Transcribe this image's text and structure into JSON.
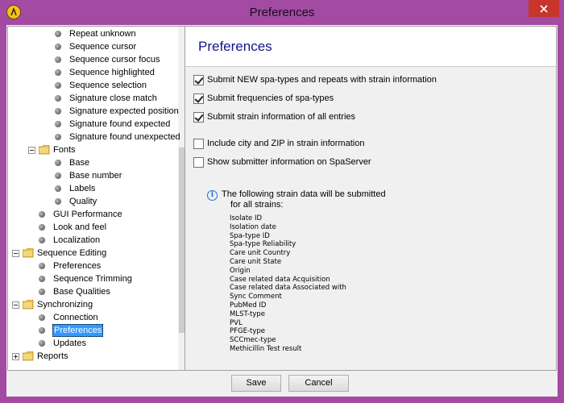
{
  "window": {
    "title": "Preferences",
    "accent_color": "#a34aa3",
    "close_color": "#c7352b"
  },
  "tree": {
    "items": [
      {
        "label": "Repeat unknown",
        "type": "leaf",
        "level": 3
      },
      {
        "label": "Sequence cursor",
        "type": "leaf",
        "level": 3
      },
      {
        "label": "Sequence cursor focus",
        "type": "leaf",
        "level": 3
      },
      {
        "label": "Sequence highlighted",
        "type": "leaf",
        "level": 3
      },
      {
        "label": "Sequence selection",
        "type": "leaf",
        "level": 3
      },
      {
        "label": "Signature close match",
        "type": "leaf",
        "level": 3
      },
      {
        "label": "Signature expected position",
        "type": "leaf",
        "level": 3
      },
      {
        "label": "Signature found expected",
        "type": "leaf",
        "level": 3
      },
      {
        "label": "Signature found unexpected",
        "type": "leaf",
        "level": 3
      },
      {
        "label": "Fonts",
        "type": "folder-open",
        "level": 2
      },
      {
        "label": "Base",
        "type": "leaf",
        "level": 3
      },
      {
        "label": "Base number",
        "type": "leaf",
        "level": 3
      },
      {
        "label": "Labels",
        "type": "leaf",
        "level": 3
      },
      {
        "label": "Quality",
        "type": "leaf",
        "level": 3
      },
      {
        "label": "GUI Performance",
        "type": "leaf",
        "level": 2
      },
      {
        "label": "Look and feel",
        "type": "leaf",
        "level": 2
      },
      {
        "label": "Localization",
        "type": "leaf",
        "level": 2
      },
      {
        "label": "Sequence Editing",
        "type": "folder-open",
        "level": 1
      },
      {
        "label": "Preferences",
        "type": "leaf",
        "level": 2
      },
      {
        "label": "Sequence Trimming",
        "type": "leaf",
        "level": 2
      },
      {
        "label": "Base Qualities",
        "type": "leaf",
        "level": 2
      },
      {
        "label": "Synchronizing",
        "type": "folder-open",
        "level": 1
      },
      {
        "label": "Connection",
        "type": "leaf",
        "level": 2
      },
      {
        "label": "Preferences",
        "type": "leaf",
        "level": 2,
        "selected": true
      },
      {
        "label": "Updates",
        "type": "leaf",
        "level": 2
      },
      {
        "label": "Reports",
        "type": "folder-closed",
        "level": 1
      }
    ]
  },
  "panel": {
    "title": "Preferences",
    "title_color": "#14148c",
    "options": [
      {
        "label": "Submit NEW spa-types and repeats with strain information",
        "checked": true
      },
      {
        "label": "Submit frequencies of spa-types",
        "checked": true
      },
      {
        "label": "Submit strain information of all entries",
        "checked": true
      },
      {
        "label": "Include city and ZIP in strain information",
        "checked": false
      },
      {
        "label": "Show submitter information on SpaServer",
        "checked": false
      }
    ],
    "info_line1": "The following strain data will be submitted",
    "info_line2": "for all strains:",
    "fields": [
      "Isolate ID",
      "Isolation date",
      "Spa-type ID",
      "Spa-type Reliability",
      "Care unit Country",
      "Care unit State",
      "Origin",
      "Case related data Acquisition",
      "Case related data Associated with",
      "Sync Comment",
      "PubMed ID",
      "MLST-type",
      "PVL",
      "PFGE-type",
      "SCCmec-type",
      "Methicillin Test result"
    ]
  },
  "buttons": {
    "save": "Save",
    "cancel": "Cancel"
  }
}
